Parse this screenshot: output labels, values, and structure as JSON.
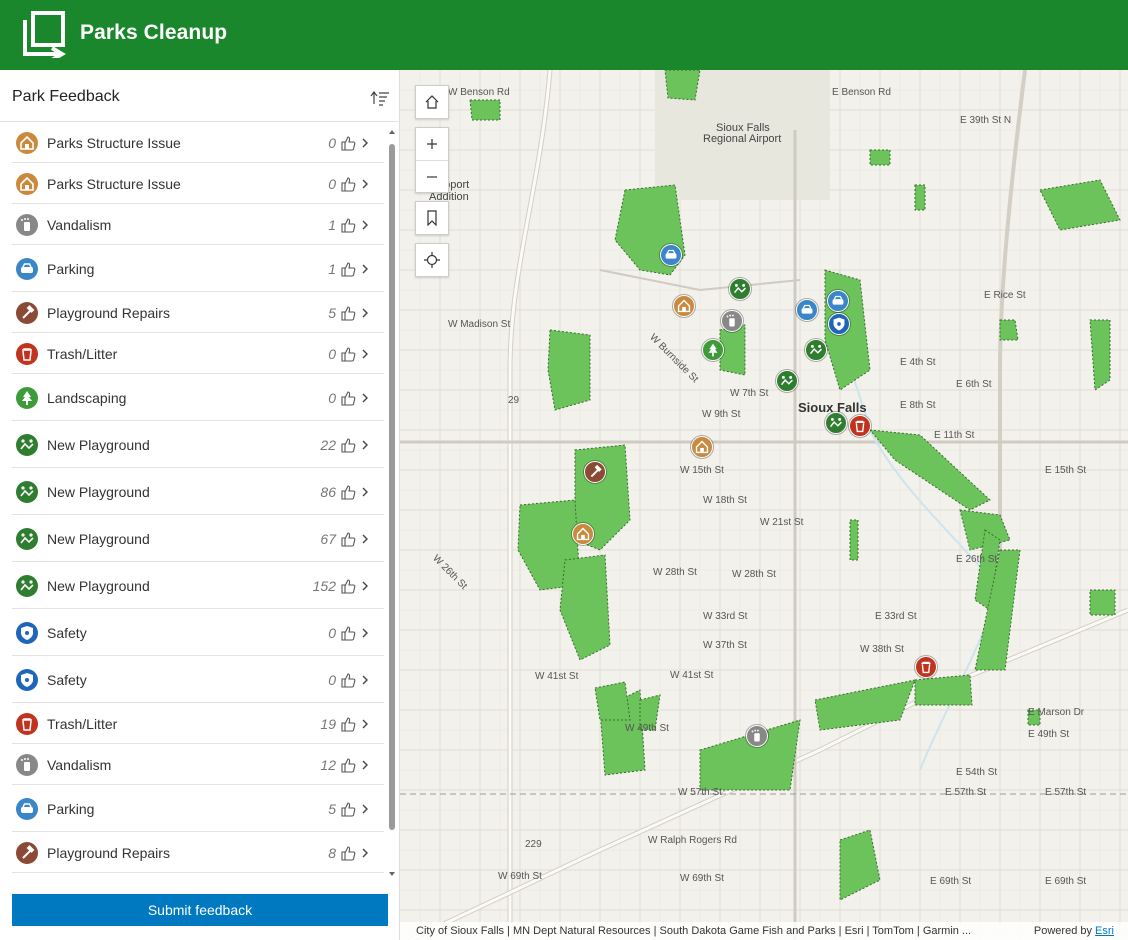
{
  "header": {
    "title": "Parks Cleanup",
    "brand_color": "#1b872d",
    "logo_icon": "app-launch-icon"
  },
  "panel": {
    "title": "Park Feedback",
    "sort_icon": "sort-icon",
    "items": [
      {
        "label": "Parks Structure Issue",
        "count": "0",
        "icon": "structure-icon",
        "color": "#c98a3e"
      },
      {
        "label": "Parks Structure Issue",
        "count": "0",
        "icon": "structure-icon",
        "color": "#c98a3e"
      },
      {
        "label": "Vandalism",
        "count": "1",
        "icon": "spray-can-icon",
        "color": "#888888"
      },
      {
        "label": "Parking",
        "count": "1",
        "icon": "car-icon",
        "color": "#3a86c8"
      },
      {
        "label": "Playground Repairs",
        "count": "5",
        "icon": "hammer-icon",
        "color": "#8b4a36"
      },
      {
        "label": "Trash/Litter",
        "count": "0",
        "icon": "trash-icon",
        "color": "#c0341f"
      },
      {
        "label": "Landscaping",
        "count": "0",
        "icon": "tree-icon",
        "color": "#3e9b3a"
      },
      {
        "label": "New Playground",
        "count": "22",
        "icon": "playground-icon",
        "color": "#2f7d2f"
      },
      {
        "label": "New Playground",
        "count": "86",
        "icon": "playground-icon",
        "color": "#2f7d2f"
      },
      {
        "label": "New Playground",
        "count": "67",
        "icon": "playground-icon",
        "color": "#2f7d2f"
      },
      {
        "label": "New Playground",
        "count": "152",
        "icon": "playground-icon",
        "color": "#2f7d2f"
      },
      {
        "label": "Safety",
        "count": "0",
        "icon": "shield-icon",
        "color": "#1f66b8"
      },
      {
        "label": "Safety",
        "count": "0",
        "icon": "shield-icon",
        "color": "#1f66b8"
      },
      {
        "label": "Trash/Litter",
        "count": "19",
        "icon": "trash-icon",
        "color": "#c0341f"
      },
      {
        "label": "Vandalism",
        "count": "12",
        "icon": "spray-can-icon",
        "color": "#888888"
      },
      {
        "label": "Parking",
        "count": "5",
        "icon": "car-icon",
        "color": "#3a86c8"
      },
      {
        "label": "Playground Repairs",
        "count": "8",
        "icon": "hammer-icon",
        "color": "#8b4a36"
      }
    ],
    "submit_label": "Submit feedback",
    "submit_color": "#0079c1"
  },
  "map": {
    "controls": [
      "home-icon",
      "zoom-in-icon",
      "zoom-out-icon",
      "bookmark-icon",
      "locate-icon"
    ],
    "labels": {
      "benson_w": "W Benson Rd",
      "benson_e": "E Benson Rd",
      "e39": "E 39th St N",
      "airport": "Sioux Falls",
      "airport2": "Regional Airport",
      "rupport": "upport",
      "rupport2": "Addition",
      "madison": "W Madison St",
      "erice": "E Rice St",
      "burnside": "W Burnside St",
      "w7": "W 7th St",
      "w9": "W 9th St",
      "e8": "E 8th St",
      "e11": "E 11th St",
      "city": "Sioux Falls",
      "e4": "E 4th St",
      "e6": "E 6th St",
      "w15": "W 15th St",
      "e15": "E 15th St",
      "w18": "W 18th St",
      "w21": "W 21st St",
      "e26": "E 26th St",
      "w26": "W 26th St",
      "w28": "W 28th St",
      "w28b": "W 28th St",
      "w33": "W 33rd St",
      "e33": "E 33rd St",
      "w37": "W 37th St",
      "w38": "W 38th St",
      "w41": "W 41st St",
      "w41b": "W 41st St",
      "w49": "W 49th St",
      "e49": "E 49th St",
      "e54": "E 54th St",
      "w57": "W 57th St",
      "e57": "E 57th St",
      "e57b": "E 57th St",
      "ralph": "W Ralph Rogers Rd",
      "w69": "W 69th St",
      "w69b": "W 69th St",
      "e69": "E 69th St",
      "e69b": "E 69th St",
      "marson": "E Marson Dr",
      "i29": "29",
      "i229": "229",
      "i229b": "229",
      "i29b": "29"
    }
  },
  "attribution": {
    "text": "City of Sioux Falls | MN Dept Natural Resources | South Dakota Game Fish and Parks | Esri | TomTom | Garmin ...",
    "powered": "Powered by",
    "esri": "Esri"
  }
}
